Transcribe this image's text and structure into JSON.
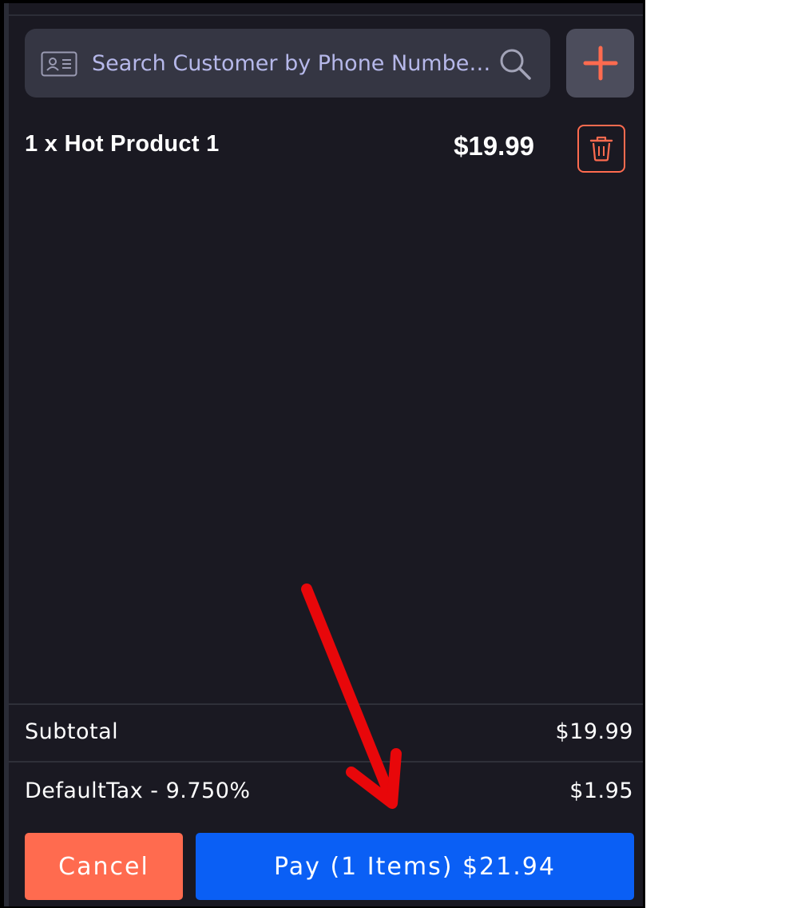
{
  "search": {
    "placeholder": "Search Customer by Phone Number..."
  },
  "icons": {
    "customer_card": "id-card-icon",
    "search": "search-icon",
    "add": "plus-icon",
    "delete": "trash-icon"
  },
  "cart": {
    "items": [
      {
        "label": "1 x Hot Product 1",
        "price": "$19.99"
      }
    ]
  },
  "summary": {
    "subtotal_label": "Subtotal",
    "subtotal_value": "$19.99",
    "tax_label": "DefaultTax - 9.750%",
    "tax_value": "$1.95"
  },
  "actions": {
    "cancel_label": "Cancel",
    "pay_label": "Pay (1 Items) $21.94"
  },
  "colors": {
    "background": "#1a1922",
    "accent_orange": "#ff6b4f",
    "pay_blue": "#0a5ff5",
    "annotation_red": "#e8070a"
  }
}
